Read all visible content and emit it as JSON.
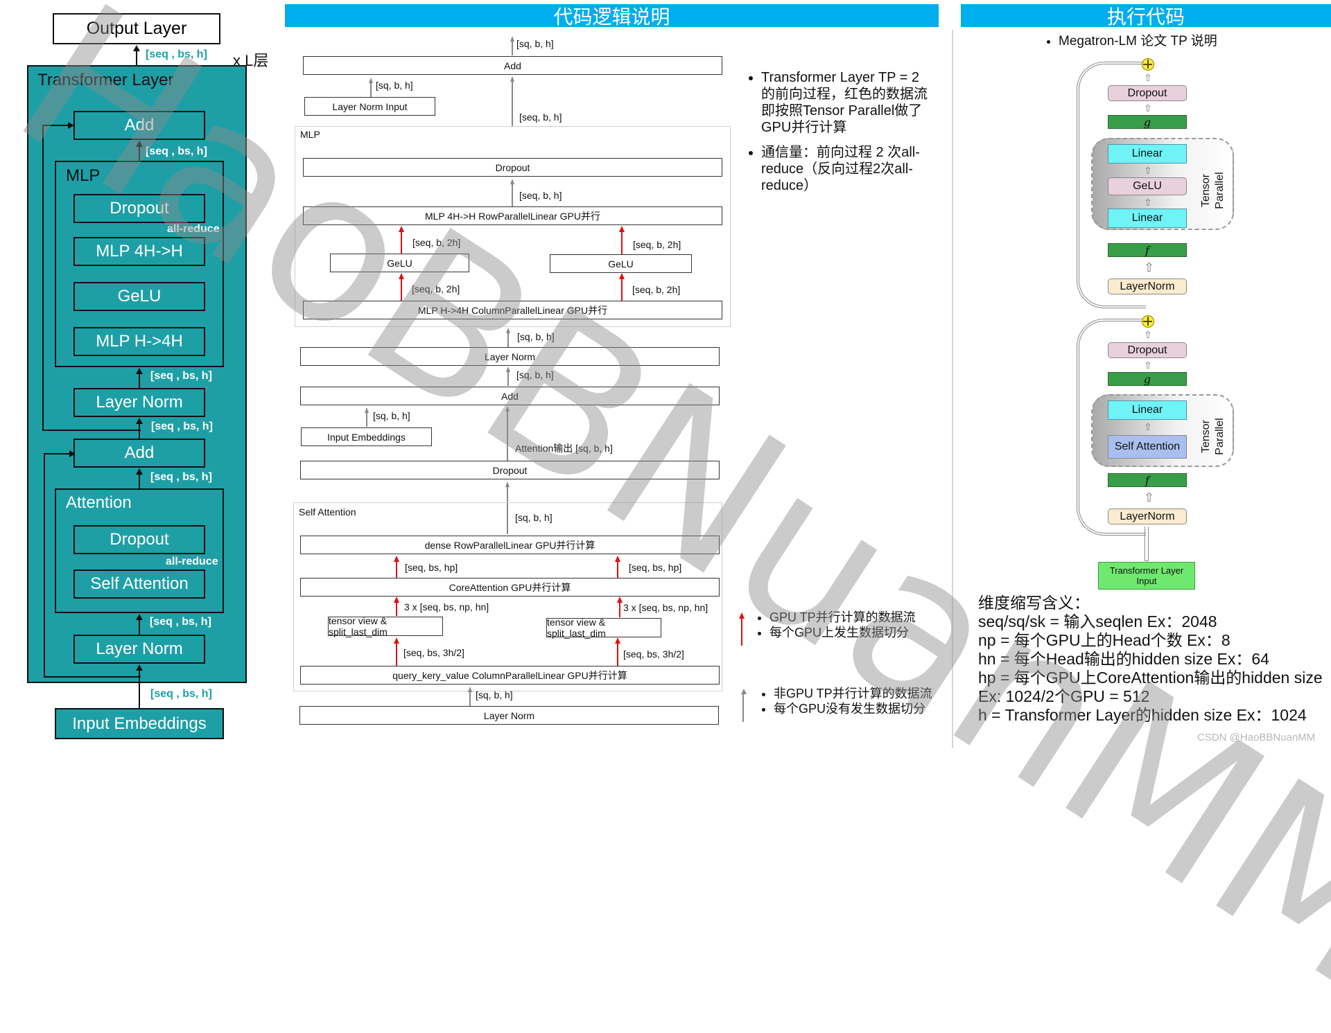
{
  "left_panel": {
    "output_layer": "Output Layer",
    "repeat_label": "x L层",
    "transformer_layer": "Transformer Layer",
    "mlp_group": "MLP",
    "attention_group": "Attention",
    "blocks": {
      "add_top": "Add",
      "mlp_dropout": "Dropout",
      "mlp_4h_h": "MLP 4H->H",
      "gelu": "GeLU",
      "mlp_h_4h": "MLP H->4H",
      "layer_norm_mid": "Layer Norm",
      "add_mid": "Add",
      "attn_dropout": "Dropout",
      "self_attention": "Self Attention",
      "layer_norm_bottom": "Layer Norm",
      "input_embeddings": "Input Embeddings"
    },
    "dim_label": "[seq , bs, h]",
    "all_reduce": "all-reduce"
  },
  "middle_panel": {
    "header": "代码逻辑说明",
    "blocks": {
      "add_top": "Add",
      "layer_norm_input": "Layer Norm Input",
      "mlp_group": "MLP",
      "dropout_mlp": "Dropout",
      "row_parallel": "MLP 4H->H RowParallelLinear GPU并行",
      "gelu_left": "GeLU",
      "gelu_right": "GeLU",
      "col_parallel": "MLP H->4H ColumnParallelLinear GPU并行",
      "layer_norm": "Layer Norm",
      "add_mid": "Add",
      "input_embeddings": "Input Embeddings",
      "dropout_attn": "Dropout",
      "self_attention_group": "Self Attention",
      "dense": "dense RowParallelLinear GPU并行计算",
      "core_attention": "CoreAttention GPU并行计算",
      "split_left": "tensor view & split_last_dim",
      "split_right": "tensor view & split_last_dim",
      "qkv": "query_kery_value ColumnParallelLinear GPU并行计算",
      "layer_norm_bottom": "Layer Norm"
    },
    "labels": {
      "sq_b_h": "[sq, b, h]",
      "seq_b_h": "[seq, b, h]",
      "seq_b_2h": "[seq, b, 2h]",
      "attn_out": "Attention输出 [sq, b, h]",
      "seq_bs_hp": "[seq, bs, hp]",
      "three_x": "3 x [seq, bs, np, hn]",
      "seq_bs_3h2": "[seq, bs, 3h/2]"
    }
  },
  "notes": {
    "bullets": [
      "Transformer Layer TP = 2 的前向过程，红色的数据流即按照Tensor Parallel做了GPU并行计算",
      "通信量：前向过程 2 次all-reduce（反向过程2次all-reduce）"
    ],
    "legend_red": [
      "GPU TP并行计算的数据流",
      "每个GPU上发生数据切分"
    ],
    "legend_gray": [
      "非GPU TP并行计算的数据流",
      "每个GPU没有发生数据切分"
    ],
    "colors": {
      "red_flow": "#e01010",
      "gray_flow": "#888888"
    }
  },
  "right_panel": {
    "header": "执行代码",
    "subtitle": "Megatron-LM 论文 TP 说明",
    "mlp_block": {
      "dropout": "Dropout",
      "g_symbol": "g",
      "linear_top": "Linear",
      "gelu": "GeLU",
      "linear_bottom": "Linear",
      "f_symbol": "f",
      "layer_norm": "LayerNorm",
      "tensor_parallel": "Tensor Parallel"
    },
    "attn_block": {
      "dropout": "Dropout",
      "g_symbol": "g",
      "linear": "Linear",
      "self_attention": "Self Attention",
      "f_symbol": "f",
      "layer_norm": "LayerNorm",
      "tensor_parallel": "Tensor Parallel"
    },
    "input": "Transformer Layer Input",
    "dims_title": "维度缩写含义：",
    "dims": [
      "seq/sq/sk = 输入seqlen Ex：2048",
      "np = 每个GPU上的Head个数 Ex：8",
      "hn = 每个Head输出的hidden size Ex：64",
      "hp  = 每个GPU上CoreAttention输出的hidden size",
      "Ex: 1024/2个GPU = 512",
      "h = Transformer Layer的hidden size Ex：1024"
    ]
  },
  "watermark": "HaoBBNuanMM",
  "credit": "CSDN @HaoBBNuanMM"
}
